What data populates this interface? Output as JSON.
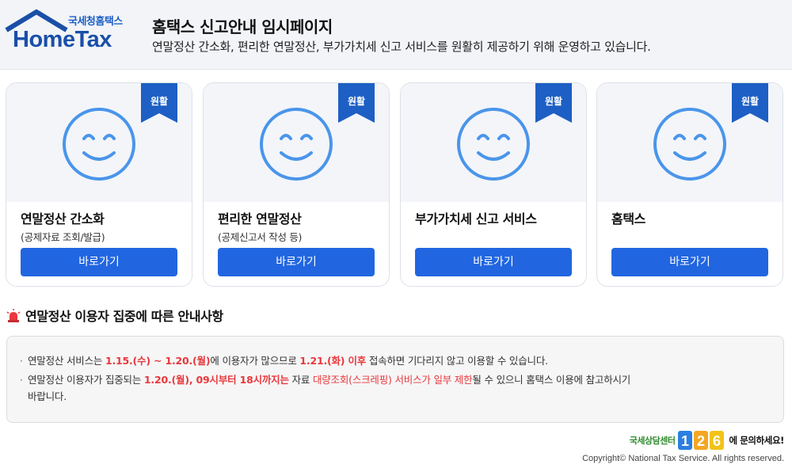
{
  "header": {
    "logo_sub": "국세청홈택스",
    "logo_main": "HomeTax",
    "title": "홈택스 신고안내 임시페이지",
    "description": "연말정산 간소화, 편리한 연말정산, 부가가치세 신고 서비스를 원활히 제공하기 위해 운영하고 있습니다."
  },
  "cards": [
    {
      "badge": "원활",
      "title": "연말정산 간소화",
      "subtitle": "(공제자료 조회/발급)",
      "button": "바로가기"
    },
    {
      "badge": "원활",
      "title": "편리한 연말정산",
      "subtitle": "(공제신고서 작성 등)",
      "button": "바로가기"
    },
    {
      "badge": "원활",
      "title": "부가가치세 신고 서비스",
      "subtitle": "",
      "button": "바로가기"
    },
    {
      "badge": "원활",
      "title": "홈택스",
      "subtitle": "",
      "button": "바로가기"
    }
  ],
  "notice": {
    "title": "연말정산 이용자 집중에 따른 안내사항",
    "line1": {
      "t1": "연말정산 서비스는 ",
      "h1": "1.15.(수) ~ 1.20.(월)",
      "t2": "에 이용자가 많으므로 ",
      "h2": "1.21.(화) 이후",
      "t3": " 접속하면 기다리지 않고 이용할 수 있습니다."
    },
    "line2": {
      "t1": "연말정산 이용자가 집중되는 ",
      "h1": "1.20.(월), 09시부터 18시까지는",
      "t2": " 자료 ",
      "h2": "대량조회(스크레핑) 서비스가 일부 제한",
      "t3": "될 수 있으니 홈택스 이용에 참고하시기",
      "t4": "바랍니다."
    }
  },
  "footer": {
    "call_label": "국세상담센터",
    "call_number": "126",
    "call_ask": "에 문의하세요!",
    "copyright": "Copyright© National Tax Service. All rights reserved."
  },
  "colors": {
    "accent": "#2166e0",
    "badge": "#1d5fc4",
    "face": "#4a95ea",
    "highlight": "#e8383d"
  }
}
